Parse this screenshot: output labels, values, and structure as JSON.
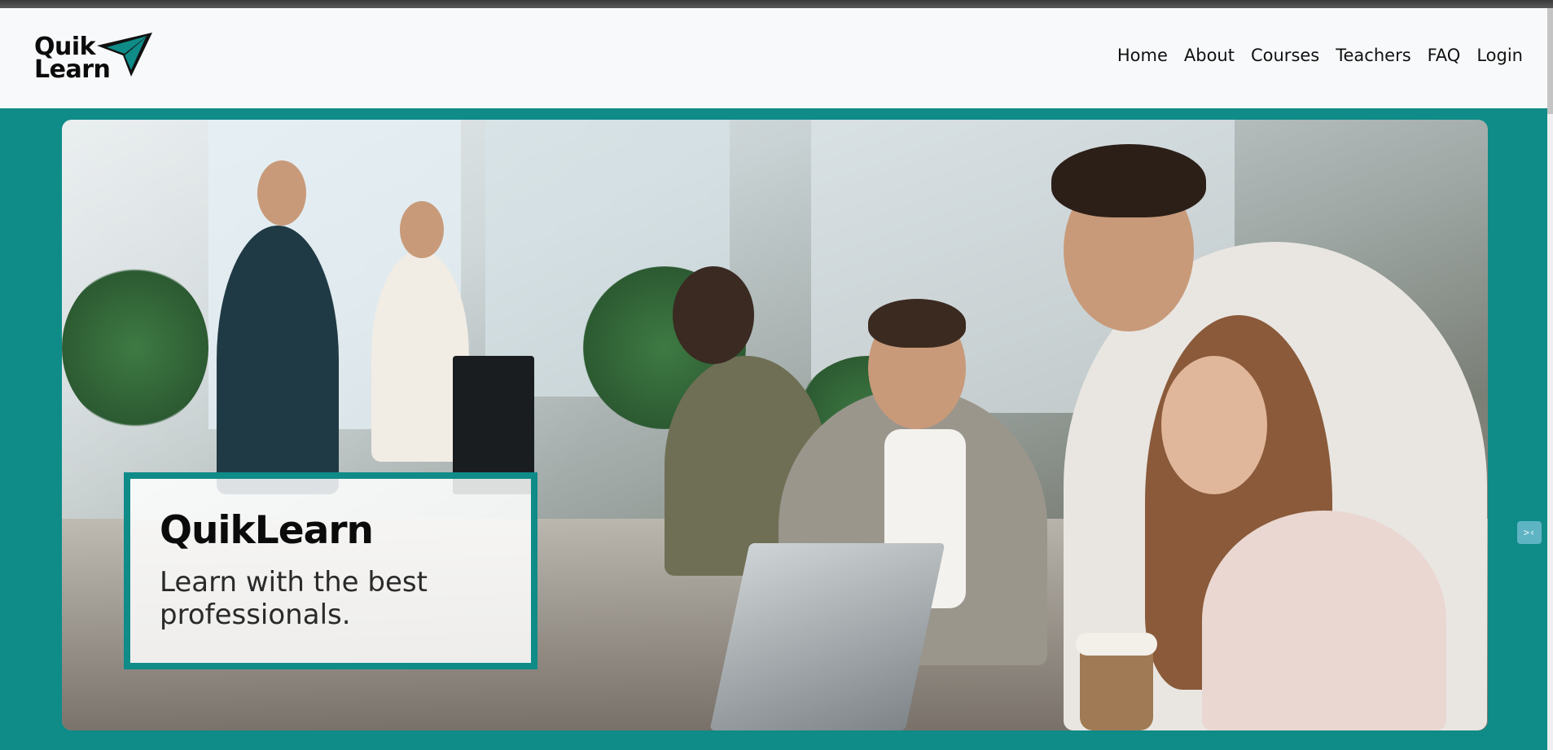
{
  "brand": {
    "name_line1": "Quik",
    "name_line2": "Learn",
    "icon": "paper-plane-icon",
    "accent_color": "#0f8b88"
  },
  "nav": {
    "items": [
      {
        "label": "Home"
      },
      {
        "label": "About"
      },
      {
        "label": "Courses"
      },
      {
        "label": "Teachers"
      },
      {
        "label": "FAQ"
      },
      {
        "label": "Login"
      }
    ]
  },
  "hero": {
    "image": "office-team-photo",
    "title": "QuikLearn",
    "subtitle": "Learn with the best professionals."
  },
  "side_widget": {
    "icon": "code-icon",
    "label": ">‹"
  },
  "colors": {
    "page_background": "#0f8b88",
    "header_background": "#f8f9fa",
    "text": "#111111"
  }
}
